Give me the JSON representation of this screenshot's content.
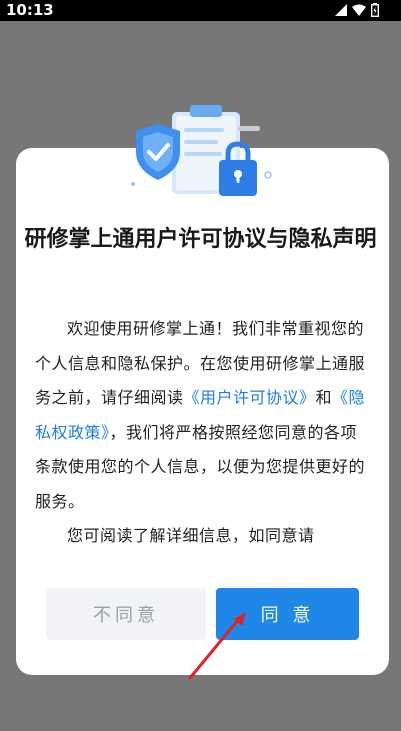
{
  "status_bar": {
    "time": "10:13",
    "icons": [
      "cellular-signal-icon",
      "wifi-icon",
      "battery-icon"
    ]
  },
  "dialog": {
    "title": "研修掌上通用户许可协议与隐私声明",
    "body": {
      "intro": "欢迎使用研修掌上通！我们非常重视您的个人信息和隐私保护。在您使用研修掌上通服务之前，请仔细阅读",
      "link_license": "《用户许可协议》",
      "connector": "和",
      "link_privacy": "《隐私权政策》",
      "after_links": "，我们将严格按照经您同意的各项条款使用您的个人信息，以便为您提供更好的服务。",
      "para2": "您可阅读了解详细信息，如同意请"
    },
    "buttons": {
      "disagree": "不同意",
      "agree": "同 意"
    }
  },
  "colors": {
    "overlay": "#777777",
    "link": "#1d7ee8",
    "agree_button": "#1f87e8",
    "disagree_button": "#f1f3f6",
    "annotation_arrow": "#e0202a"
  }
}
